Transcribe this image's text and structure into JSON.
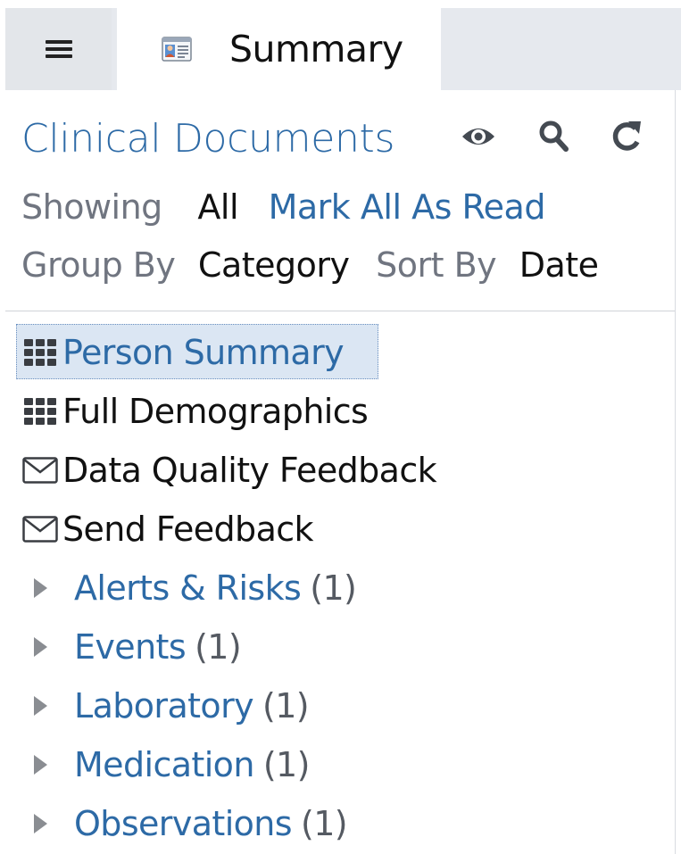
{
  "tabbar": {
    "menu_icon": "hamburger-icon",
    "tab_icon": "contact-card-icon",
    "tab_label": "Summary"
  },
  "header": {
    "title": "Clinical Documents",
    "tools": [
      "eye-icon",
      "search-icon",
      "refresh-icon"
    ],
    "showing_label": "Showing",
    "showing_value": "All",
    "mark_all_read": "Mark All As Read",
    "group_by_label": "Group By",
    "group_by_value": "Category",
    "sort_by_label": "Sort By",
    "sort_by_value": "Date"
  },
  "documents": [
    {
      "label": "Person Summary",
      "icon": "grid-icon",
      "selected": true,
      "color": "#2d6aa6"
    },
    {
      "label": "Full Demographics",
      "icon": "grid-icon",
      "selected": false,
      "color": "#111111"
    },
    {
      "label": "Data Quality Feedback",
      "icon": "envelope-icon",
      "selected": false,
      "color": "#111111"
    },
    {
      "label": "Send Feedback",
      "icon": "envelope-icon",
      "selected": false,
      "color": "#111111"
    }
  ],
  "categories": [
    {
      "name": "Alerts & Risks",
      "count": "(1)"
    },
    {
      "name": "Events",
      "count": "(1)"
    },
    {
      "name": "Laboratory",
      "count": "(1)"
    },
    {
      "name": "Medication",
      "count": "(1)"
    },
    {
      "name": "Observations",
      "count": "(1)"
    }
  ],
  "colors": {
    "accent": "#2d6aa6",
    "tabbar_bg": "#e6e9ee",
    "selected_bg": "#dbe6f3"
  }
}
